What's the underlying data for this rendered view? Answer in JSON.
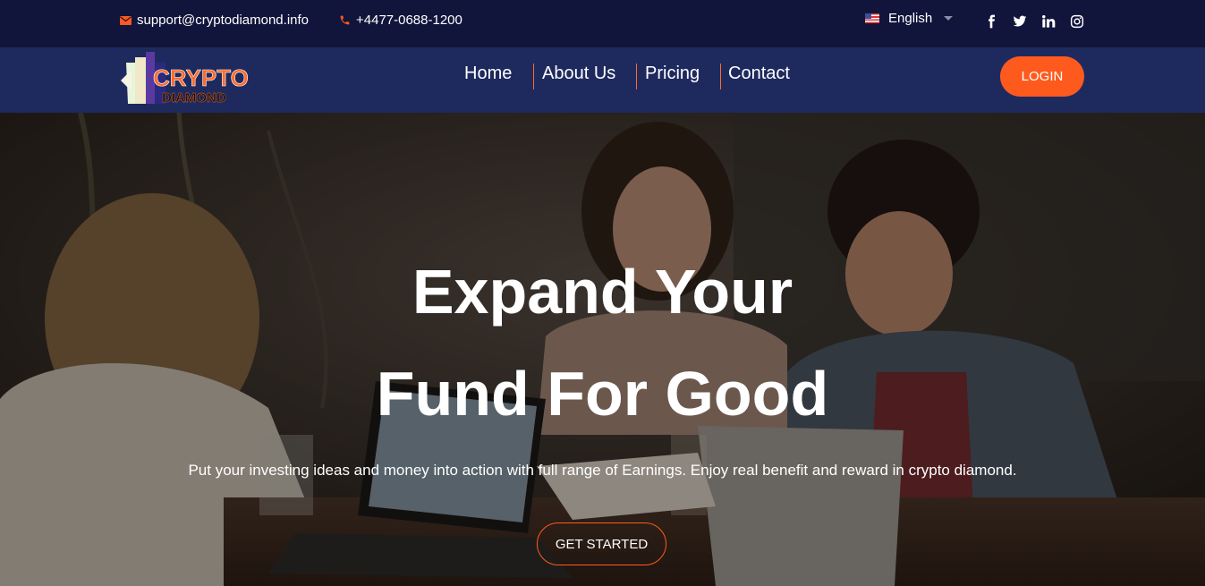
{
  "topbar": {
    "email": "support@cryptodiamond.info",
    "phone": "+4477-0688-1200",
    "language": "English",
    "social_icons": [
      "facebook-icon",
      "twitter-icon",
      "linkedin-icon",
      "instagram-icon"
    ]
  },
  "brand": {
    "logo_line1": "CRYPTO",
    "logo_line2": "DIAMOND"
  },
  "nav": {
    "items": [
      {
        "label": "Home"
      },
      {
        "label": "About Us"
      },
      {
        "label": "Pricing"
      },
      {
        "label": "Contact"
      }
    ],
    "login_label": "LOGIN"
  },
  "hero": {
    "title_line1": "Expand Your",
    "title_line2": "Fund For Good",
    "subtitle": "Put your investing ideas and money into action with full range of Earnings. Enjoy real benefit and reward in crypto diamond.",
    "cta_label": "GET STARTED"
  },
  "colors": {
    "topbar_bg": "#11143b",
    "navbar_bg": "#1e2a5e",
    "accent": "#ff5a1e"
  }
}
